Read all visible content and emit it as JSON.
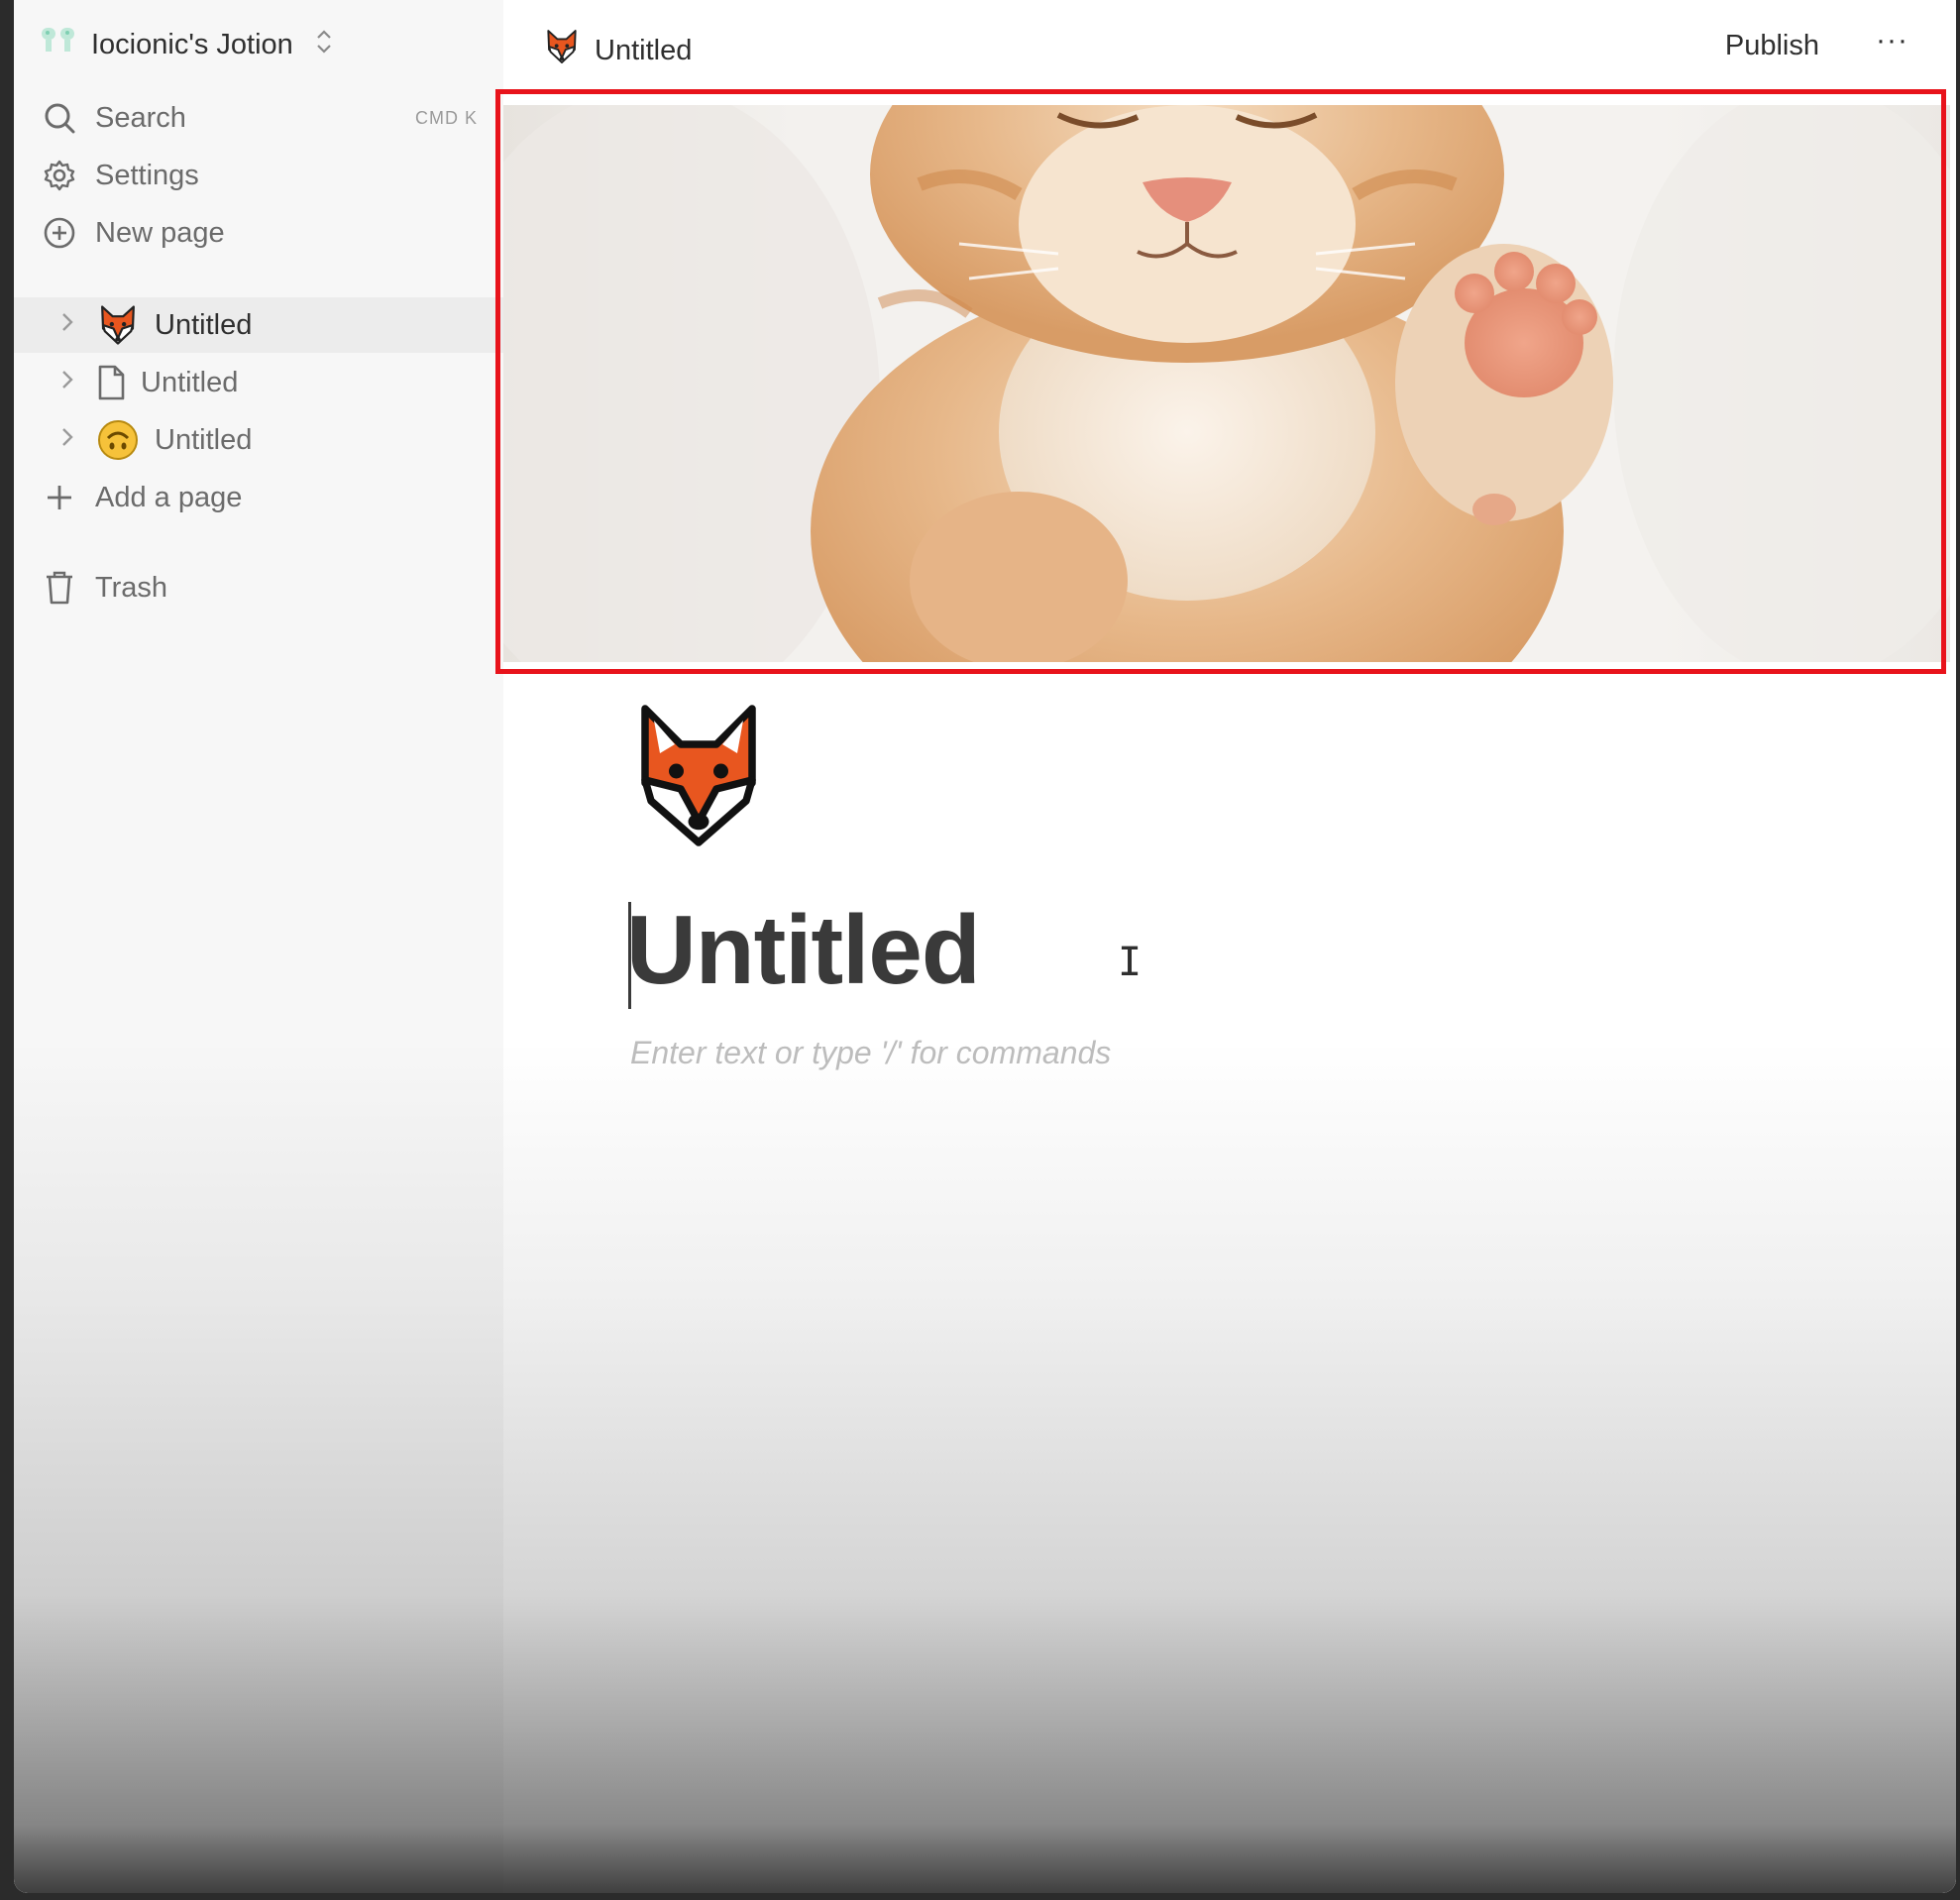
{
  "sidebar": {
    "workspace_name": "Iocionic's Jotion",
    "workspace_icon": "logo-icon",
    "search": {
      "label": "Search",
      "shortcut": "CMD K",
      "icon": "search-icon"
    },
    "settings": {
      "label": "Settings",
      "icon": "gear-icon"
    },
    "new_page": {
      "label": "New page",
      "icon": "plus-circle-icon"
    },
    "pages": [
      {
        "label": "Untitled",
        "icon": "fox-icon",
        "active": true
      },
      {
        "label": "Untitled",
        "icon": "document-icon",
        "active": false
      },
      {
        "label": "Untitled",
        "icon": "upside-down-face-icon",
        "active": false
      }
    ],
    "add_page": {
      "label": "Add a page",
      "icon": "plus-icon"
    },
    "trash": {
      "label": "Trash",
      "icon": "trash-icon"
    }
  },
  "header": {
    "breadcrumb_title": "Untitled",
    "breadcrumb_icon": "fox-icon",
    "publish_label": "Publish",
    "more_label": "···"
  },
  "document": {
    "cover_image": "sleeping-kitten-cover",
    "page_icon": "fox-icon",
    "title": "Untitled",
    "placeholder": "Enter text or type '/' for commands"
  },
  "colors": {
    "selection_outline": "#e8131b",
    "sidebar_bg": "#f7f7f7",
    "active_row_bg": "#ececec",
    "text": "#2f2f2f",
    "muted_text": "#6b6b6b"
  }
}
